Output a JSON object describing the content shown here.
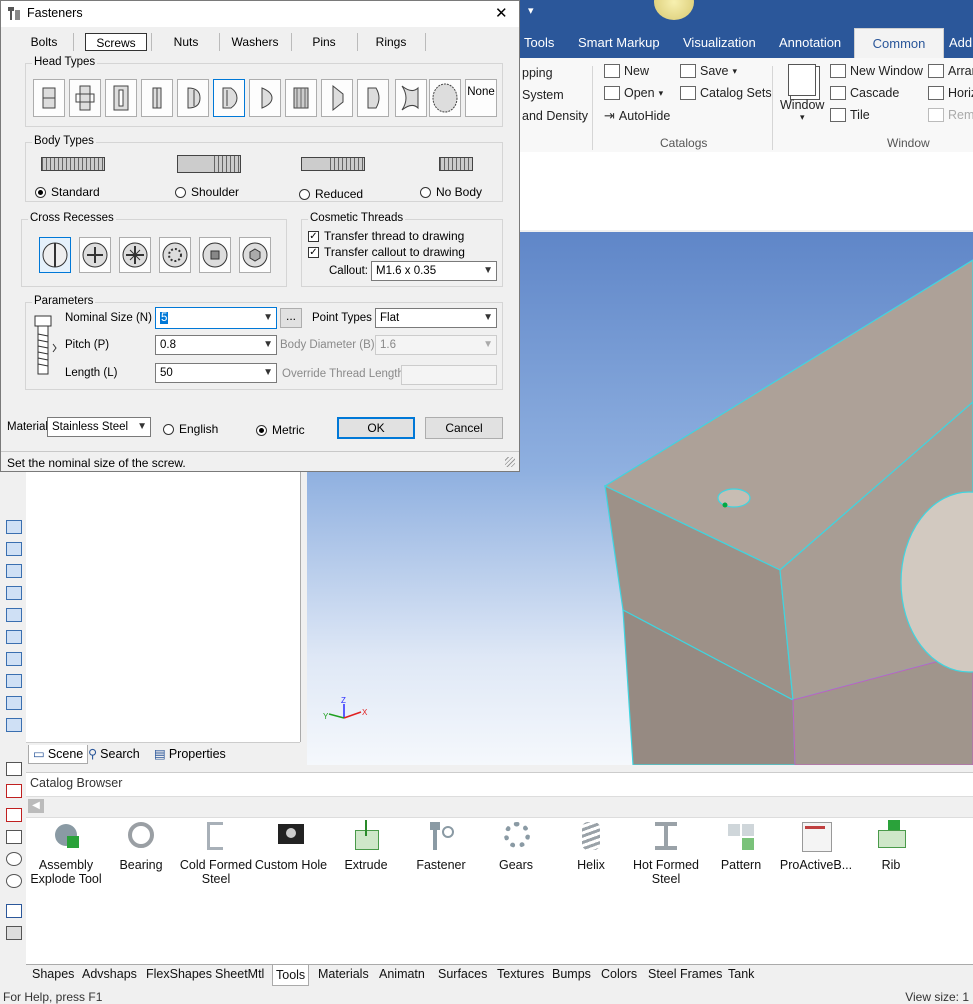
{
  "dialog": {
    "title": "Fasteners",
    "close_glyph": "✕",
    "tabs": [
      "Bolts",
      "Screws",
      "Nuts",
      "Washers",
      "Pins",
      "Rings"
    ],
    "active_tab": "Screws",
    "head_types_label": "Head Types",
    "head_none_label": "None",
    "body_types_label": "Body Types",
    "body_types": [
      "Standard",
      "Shoulder",
      "Reduced",
      "No Body"
    ],
    "selected_body": "Standard",
    "cross_recesses_label": "Cross Recesses",
    "cosmetic_threads": {
      "label": "Cosmetic Threads",
      "transfer_thread": "Transfer thread to drawing",
      "transfer_callout": "Transfer callout to drawing",
      "callout_label": "Callout:",
      "callout_value": "M1.6 x 0.35"
    },
    "parameters": {
      "label": "Parameters",
      "nominal_size_label": "Nominal Size (N)",
      "nominal_size_value": "5",
      "browse_label": "...",
      "point_types_label": "Point Types",
      "point_types_value": "Flat",
      "pitch_label": "Pitch (P)",
      "pitch_value": "0.8",
      "body_diameter_label": "Body Diameter (B)",
      "body_diameter_value": "1.6",
      "length_label": "Length (L)",
      "length_value": "50",
      "override_label": "Override Thread Length",
      "override_value": ""
    },
    "material_label": "Material",
    "material_value": "Stainless Steel",
    "units": [
      "English",
      "Metric"
    ],
    "selected_unit": "Metric",
    "ok_label": "OK",
    "cancel_label": "Cancel",
    "hint": "Set the nominal size of the screw."
  },
  "ribbon": {
    "tabs": [
      "Tools",
      "Smart Markup",
      "Visualization",
      "Annotation",
      "Common",
      "Add"
    ],
    "active_tab": "Common",
    "partial_items": [
      "pping",
      "System",
      "and Density"
    ],
    "catalogs": {
      "new": "New",
      "open": "Open",
      "autohide": "AutoHide",
      "save": "Save",
      "catalog_sets": "Catalog Sets",
      "group": "Catalogs"
    },
    "window": {
      "window": "Window",
      "new_window": "New Window",
      "cascade": "Cascade",
      "tile": "Tile",
      "arrange": "Arran",
      "horiz": "Horiz",
      "remove": "Rem",
      "group": "Window"
    }
  },
  "scene_tabs": [
    "Scene",
    "Search",
    "Properties"
  ],
  "axis_labels": {
    "z": "Z",
    "x": "X",
    "y": "Y"
  },
  "catalog": {
    "title": "Catalog Browser",
    "items": [
      "Assembly Explode Tool",
      "Bearing",
      "Cold Formed Steel",
      "Custom Hole",
      "Extrude",
      "Fastener",
      "Gears",
      "Helix",
      "Hot Formed Steel",
      "Pattern",
      "ProActiveB...",
      "Rib"
    ]
  },
  "bottom_tabs": [
    "Shapes",
    "Advshaps",
    "FlexShapes",
    "SheetMtl",
    "Tools",
    "Materials",
    "Animatn",
    "Surfaces",
    "Textures",
    "Bumps",
    "Colors",
    "Steel Frames",
    "Tank"
  ],
  "active_bottom_tab": "Tools",
  "status": {
    "help": "For Help, press F1",
    "view_size": "View size: 1"
  },
  "colors": {
    "ribbon": "#2b579a",
    "selection": "#0078d7",
    "edge": "#3fd5e0",
    "part": "#b8aca2"
  }
}
